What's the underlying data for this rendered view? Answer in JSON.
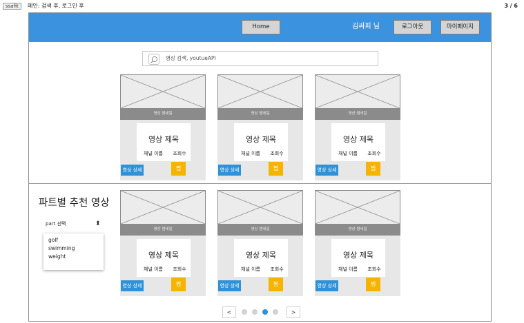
{
  "header": {
    "tag": "ssafit",
    "breadcrumb": "메인: 검색 후, 로그인 후",
    "page_indicator": "3 / 6"
  },
  "nav": {
    "home_label": "Home",
    "user_name": "김싸피 님",
    "logout_label": "로그아웃",
    "mypage_label": "마이페이지"
  },
  "search": {
    "placeholder": "영상 검색, youtueAPI"
  },
  "cards": {
    "thumbnail_label": "영상 썸네일",
    "title": "영상 제목",
    "channel": "채널 이름",
    "views": "조회수",
    "detail_label": "영상 상세",
    "fav_label": "찜"
  },
  "part_section": {
    "title": "파트별 추천 영상",
    "select_label": "part 선택",
    "options": [
      "golf",
      "swimming",
      "weight"
    ]
  },
  "pagination": {
    "prev": "<",
    "next": ">",
    "active_index": 2,
    "total": 4
  },
  "colors": {
    "nav": "#3b93df",
    "detail_button": "#2f91d7",
    "fav_button": "#f4b400",
    "thumbnail_bar": "#8b8b8b"
  }
}
